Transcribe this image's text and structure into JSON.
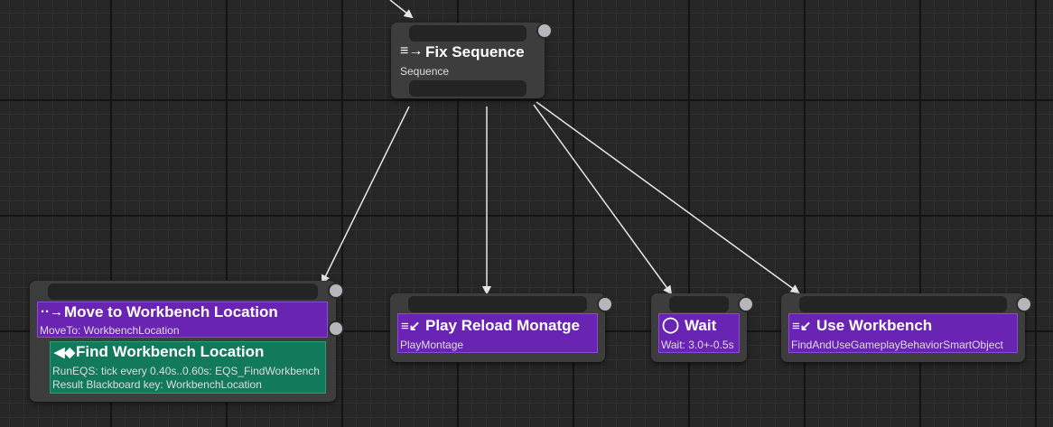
{
  "fix_sequence": {
    "title": "Fix Sequence",
    "subtitle": "Sequence"
  },
  "move_to": {
    "title": "Move to Workbench Location",
    "subtitle": "MoveTo: WorkbenchLocation"
  },
  "find_workbench": {
    "title": "Find Workbench Location",
    "line1": "RunEQS: tick every 0.40s..0.60s: EQS_FindWorkbench",
    "line2": "Result Blackboard key: WorkbenchLocation"
  },
  "play_reload": {
    "title": "Play Reload Monatge",
    "subtitle": "PlayMontage"
  },
  "wait": {
    "title": "Wait",
    "subtitle": "Wait: 3.0+-0.5s"
  },
  "use_workbench": {
    "title": "Use Workbench",
    "subtitle": "FindAndUseGameplayBehaviorSmartObject"
  },
  "colors": {
    "task": "#6a24b4",
    "service": "#127a5a",
    "node": "#3d3d3d",
    "wire": "#e6e6e6"
  },
  "icons": {
    "composite": "sequence-icon",
    "move": "move-to-icon",
    "service": "service-icon",
    "montage": "play-montage-icon",
    "wait": "wait-icon",
    "use": "use-smart-object-icon"
  }
}
